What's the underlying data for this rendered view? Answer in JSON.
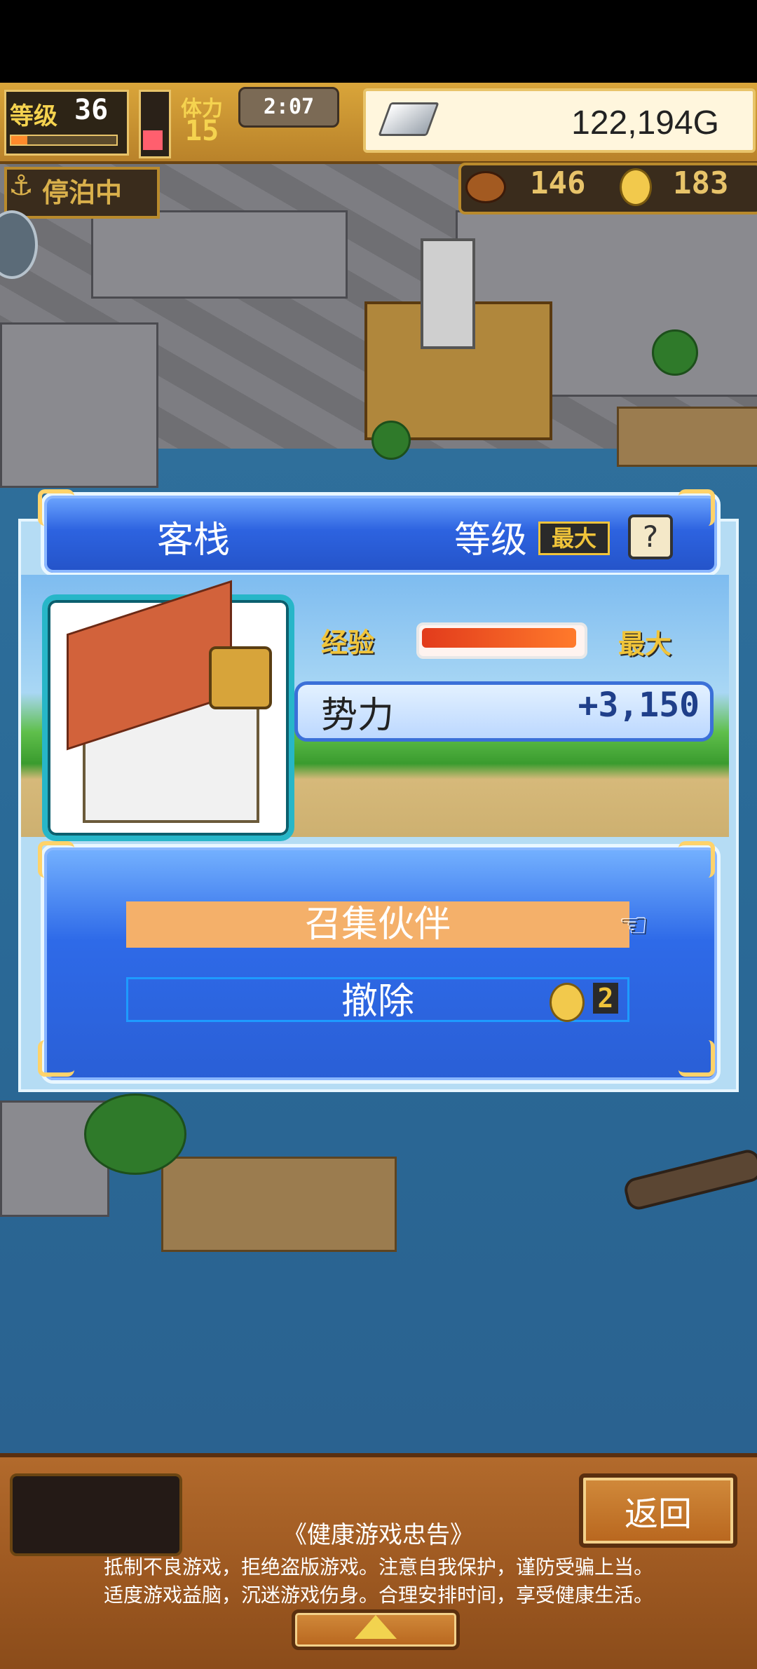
{
  "hud": {
    "level_label": "等级",
    "level_value": "36",
    "stamina_label": "体力",
    "stamina_value": "15",
    "clock": "2:07",
    "gold_value": "122,194G",
    "status_label": "停泊中",
    "food_value": "146",
    "coin_value": "183",
    "level_progress": 0.15,
    "stamina_fill": 0.35
  },
  "building": {
    "name": "客栈",
    "level_text": "等级",
    "level_badge": "最大",
    "help_label": "?",
    "exp_label": "经验",
    "exp_max_label": "最大",
    "exp_fill": 1.0,
    "influence_label": "势力",
    "influence_value": "+3,150"
  },
  "actions": {
    "recruit_label": "召集伙伴",
    "remove_label": "撤除",
    "remove_cost": "2"
  },
  "bottom": {
    "back_label": "返回",
    "health_title": "《健康游戏忠告》",
    "health_line1": "抵制不良游戏，拒绝盗版游戏。注意自我保护，谨防受骗上当。",
    "health_line2": "适度游戏益脑，沉迷游戏伤身。合理安排时间，享受健康生活。"
  },
  "icons": {
    "anchor": "anchor-icon",
    "pointer": "pointing-hand-icon",
    "coin": "coin-icon",
    "silver": "silver-bar-icon",
    "food": "food-icon",
    "expand": "expand-up-icon"
  },
  "colors": {
    "accent_blue": "#2d63e0",
    "recruit_orange": "#f4b06a",
    "gold": "#f0c43a"
  }
}
